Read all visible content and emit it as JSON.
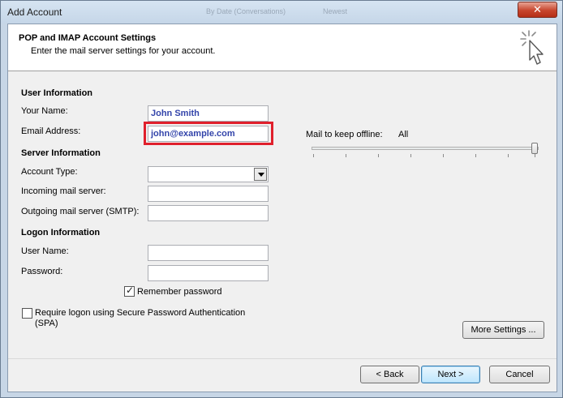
{
  "window": {
    "title": "Add Account",
    "close_symbol": "✕",
    "ghost_text_1": "By Date (Conversations)",
    "ghost_text_2": "Newest"
  },
  "header": {
    "title": "POP and IMAP Account Settings",
    "subtitle": "Enter the mail server settings for your account.",
    "icon": "cursor-sparkle-icon"
  },
  "user_info": {
    "section": "User Information",
    "name_label": "Your Name:",
    "name_value": "John Smith",
    "email_label": "Email Address:",
    "email_value": "john@example.com"
  },
  "server_info": {
    "section": "Server Information",
    "account_type_label": "Account Type:",
    "account_type_value": "",
    "incoming_label": "Incoming mail server:",
    "incoming_value": "",
    "outgoing_label": "Outgoing mail server (SMTP):",
    "outgoing_value": ""
  },
  "logon_info": {
    "section": "Logon Information",
    "username_label": "User Name:",
    "username_value": "",
    "password_label": "Password:",
    "password_value": "",
    "remember_label": "Remember password",
    "remember_checked": true,
    "spa_label_1": "Require logon using Secure Password Authentication",
    "spa_label_2": "(SPA)",
    "spa_checked": false
  },
  "offline": {
    "label": "Mail to keep offline:",
    "value": "All",
    "slider_position_fraction": 1.0
  },
  "buttons": {
    "more_settings": "More Settings ...",
    "back": "< Back",
    "next": "Next >",
    "cancel": "Cancel"
  },
  "colors": {
    "highlight_border": "#e0202c",
    "filled_text": "#3344aa"
  }
}
